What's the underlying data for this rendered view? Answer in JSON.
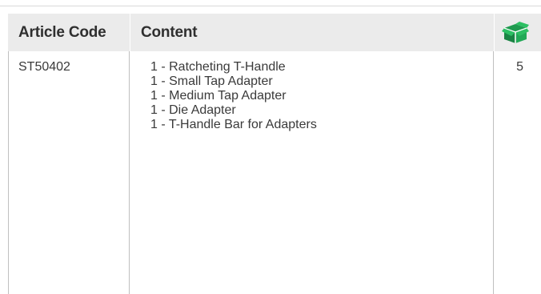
{
  "table": {
    "headers": {
      "article_code": "Article Code",
      "content": "Content",
      "qty_icon": "box-icon"
    },
    "rows": [
      {
        "article_code": "ST50402",
        "content": [
          "1 - Ratcheting T-Handle",
          "1 - Small Tap Adapter",
          "1 - Medium Tap Adapter",
          "1 - Die Adapter",
          "1 - T-Handle Bar for Adapters"
        ],
        "quantity": "5"
      }
    ]
  },
  "colors": {
    "header_bg": "#ebebeb",
    "icon_green": "#1f9a4f",
    "border": "#bfbfbf"
  }
}
